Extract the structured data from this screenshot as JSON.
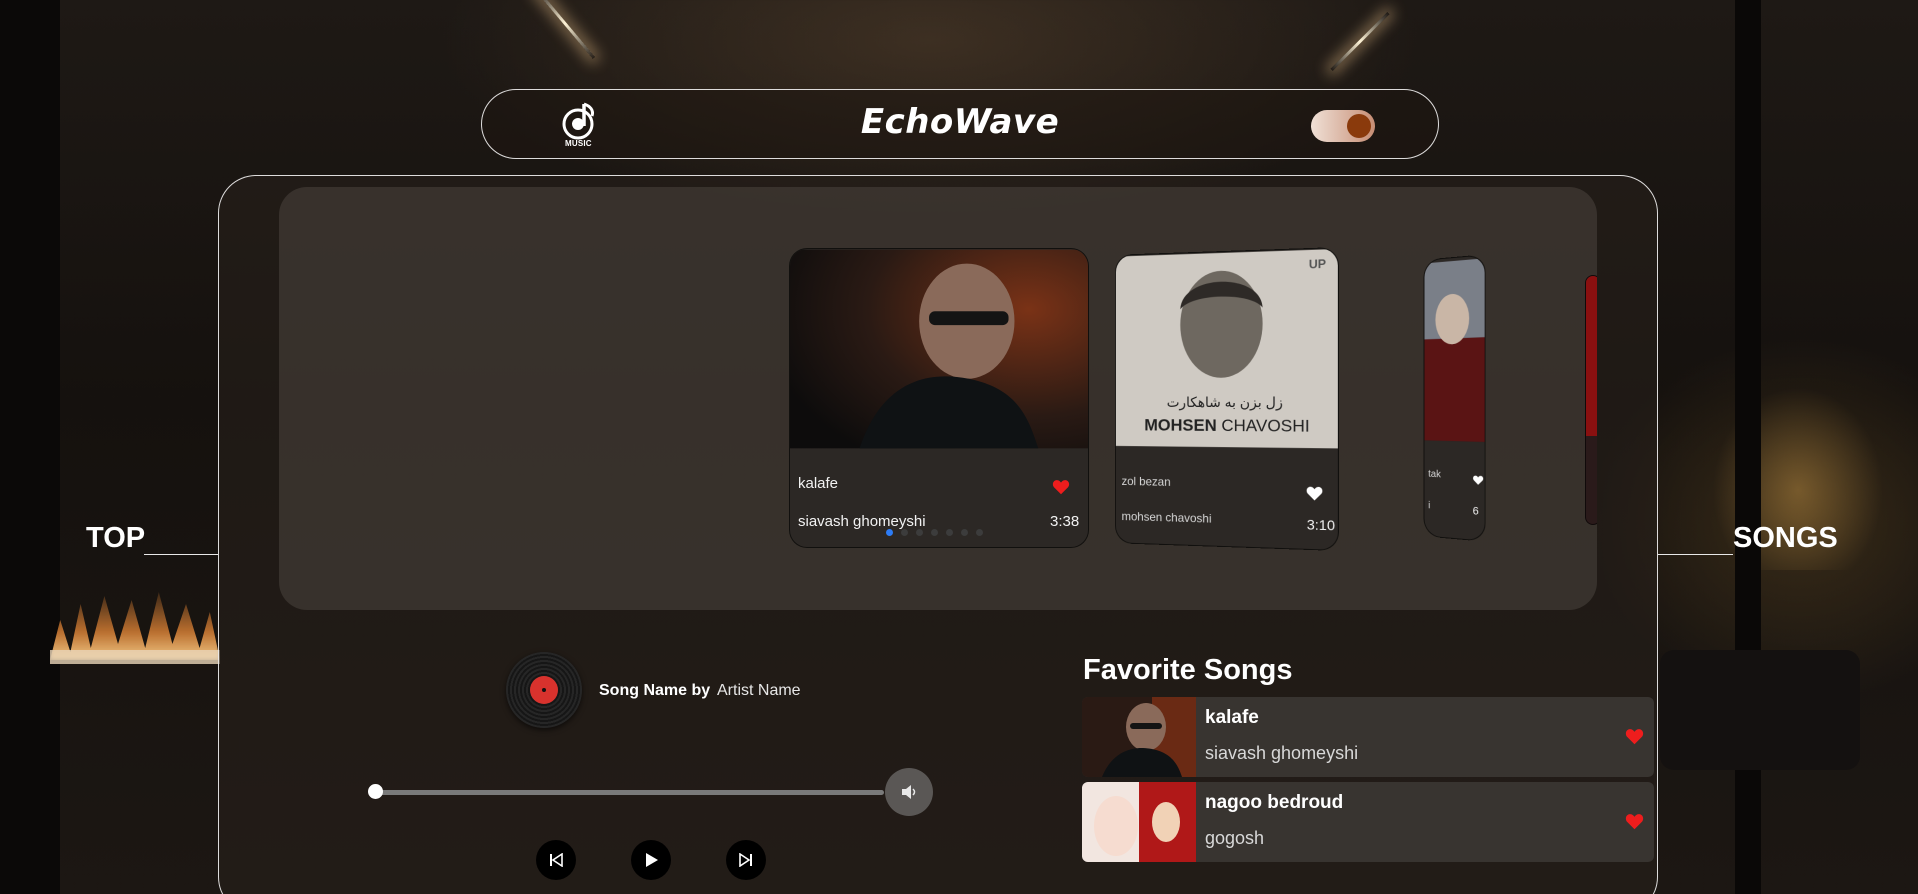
{
  "app": {
    "brand": "EchoWave",
    "logo_text": "MUSIC"
  },
  "side_labels": {
    "left": "TOP",
    "right": "SONGS"
  },
  "theme_toggle": {
    "state": "on"
  },
  "carousel": {
    "cards": [
      {
        "title": "kalafe",
        "artist": "siavash ghomeyshi",
        "duration": "3:38",
        "liked": true
      },
      {
        "title": "zol bezan",
        "artist": "mohsen chavoshi",
        "duration": "3:10",
        "liked": false,
        "art_text": "MOHSEN",
        "art_text2": "CHAVOSHI",
        "art_persian": "زل بزن به شاهکارت",
        "art_badge": "UP"
      },
      {
        "title": "tak",
        "artist": "i",
        "duration": "6",
        "liked": false
      }
    ],
    "page_count": 7,
    "active_page": 1
  },
  "player": {
    "song_label": "Song Name by",
    "artist_label": "Artist Name",
    "progress": 0
  },
  "favorites": {
    "title": "Favorite Songs",
    "items": [
      {
        "name": "kalafe",
        "artist": "siavash ghomeyshi"
      },
      {
        "name": "nagoo bedroud",
        "artist": "gogosh"
      }
    ]
  },
  "colors": {
    "accent": "#2d7cf6",
    "heart_liked": "#ee1d1d",
    "heart_unliked": "#ffffff",
    "vinyl_label": "#d8322d"
  },
  "icons": [
    "music-note-icon",
    "heart-icon",
    "volume-icon",
    "previous-icon",
    "play-icon",
    "next-icon"
  ]
}
